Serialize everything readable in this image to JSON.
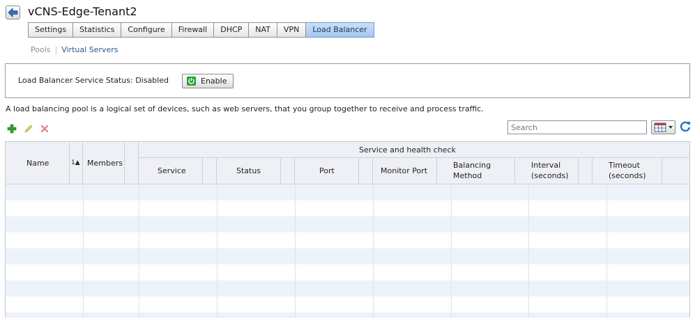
{
  "header": {
    "title": "vCNS-Edge-Tenant2"
  },
  "tabs": [
    {
      "label": "Settings",
      "active": false
    },
    {
      "label": "Statistics",
      "active": false
    },
    {
      "label": "Configure",
      "active": false
    },
    {
      "label": "Firewall",
      "active": false
    },
    {
      "label": "DHCP",
      "active": false
    },
    {
      "label": "NAT",
      "active": false
    },
    {
      "label": "VPN",
      "active": false
    },
    {
      "label": "Load Balancer",
      "active": true
    }
  ],
  "subnav": {
    "pools": "Pools",
    "separator": "|",
    "virtual_servers": "Virtual Servers"
  },
  "status": {
    "label": "Load Balancer Service Status:",
    "value": "Disabled",
    "enable_label": "Enable"
  },
  "description": "A load balancing pool is a logical set of devices, such as web servers, that you group together to receive and process traffic.",
  "search": {
    "placeholder": "Search",
    "value": ""
  },
  "grid": {
    "group_header": "Service and health check",
    "columns": {
      "name": "Name",
      "sort_indicator": "1▲",
      "members": "Members",
      "service": "Service",
      "status": "Status",
      "port": "Port",
      "monitor_port": "Monitor Port",
      "balancing_method_1": "Balancing",
      "balancing_method_2": "Method",
      "interval_1": "Interval",
      "interval_2": "(seconds)",
      "timeout_1": "Timeout",
      "timeout_2": "(seconds)"
    }
  },
  "colors": {
    "active_tab": "#a4c8ee",
    "link": "#2b5a8a",
    "add_icon": "#2e9e2e",
    "delete_icon": "#d9534f",
    "refresh_icon": "#1f73c9",
    "alt_row": "#eef2fb"
  }
}
